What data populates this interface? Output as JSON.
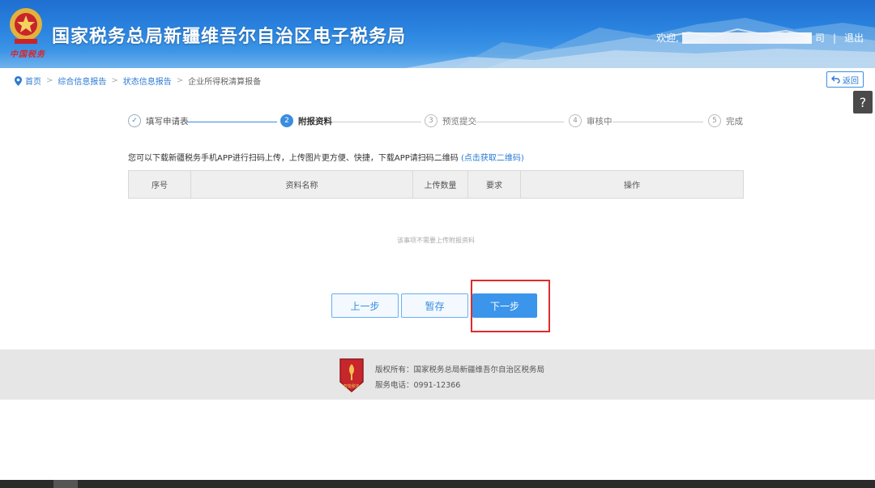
{
  "header": {
    "title": "国家税务总局新疆维吾尔自治区电子税务局",
    "motto": "中国税务",
    "welcome": "欢迎,",
    "user_tail": "司",
    "separator": "|",
    "logout": "退出"
  },
  "breadcrumb": {
    "items": [
      "首页",
      "综合信息报告",
      "状态信息报告",
      "企业所得税清算报备"
    ],
    "separator": ">"
  },
  "back_button": "返回",
  "help_button": "?",
  "steps": [
    {
      "num": "✓",
      "label": "填写申请表",
      "state": "done"
    },
    {
      "num": "2",
      "label": "附报资料",
      "state": "active"
    },
    {
      "num": "3",
      "label": "预览提交",
      "state": "pending"
    },
    {
      "num": "4",
      "label": "审核中",
      "state": "pending"
    },
    {
      "num": "5",
      "label": "完成",
      "state": "pending"
    }
  ],
  "info": {
    "text": "您可以下载新疆税务手机APP进行扫码上传，上传图片更方便、快捷，下载APP请扫码二维码",
    "link": "(点击获取二维码)"
  },
  "table": {
    "columns": [
      "序号",
      "资料名称",
      "上传数量",
      "要求",
      "操作"
    ],
    "empty_tip": "该事项不需要上传附报资料"
  },
  "buttons": {
    "prev": "上一步",
    "save": "暂存",
    "next": "下一步"
  },
  "footer": {
    "copyright": "版权所有：国家税务总局新疆维吾尔自治区税务局",
    "phone": "服务电话：0991-12366",
    "logo_text": "智能税务"
  },
  "colors": {
    "header_blue": "#2b84e0",
    "accent": "#3b95ea",
    "highlight_red": "#e02b2b"
  }
}
